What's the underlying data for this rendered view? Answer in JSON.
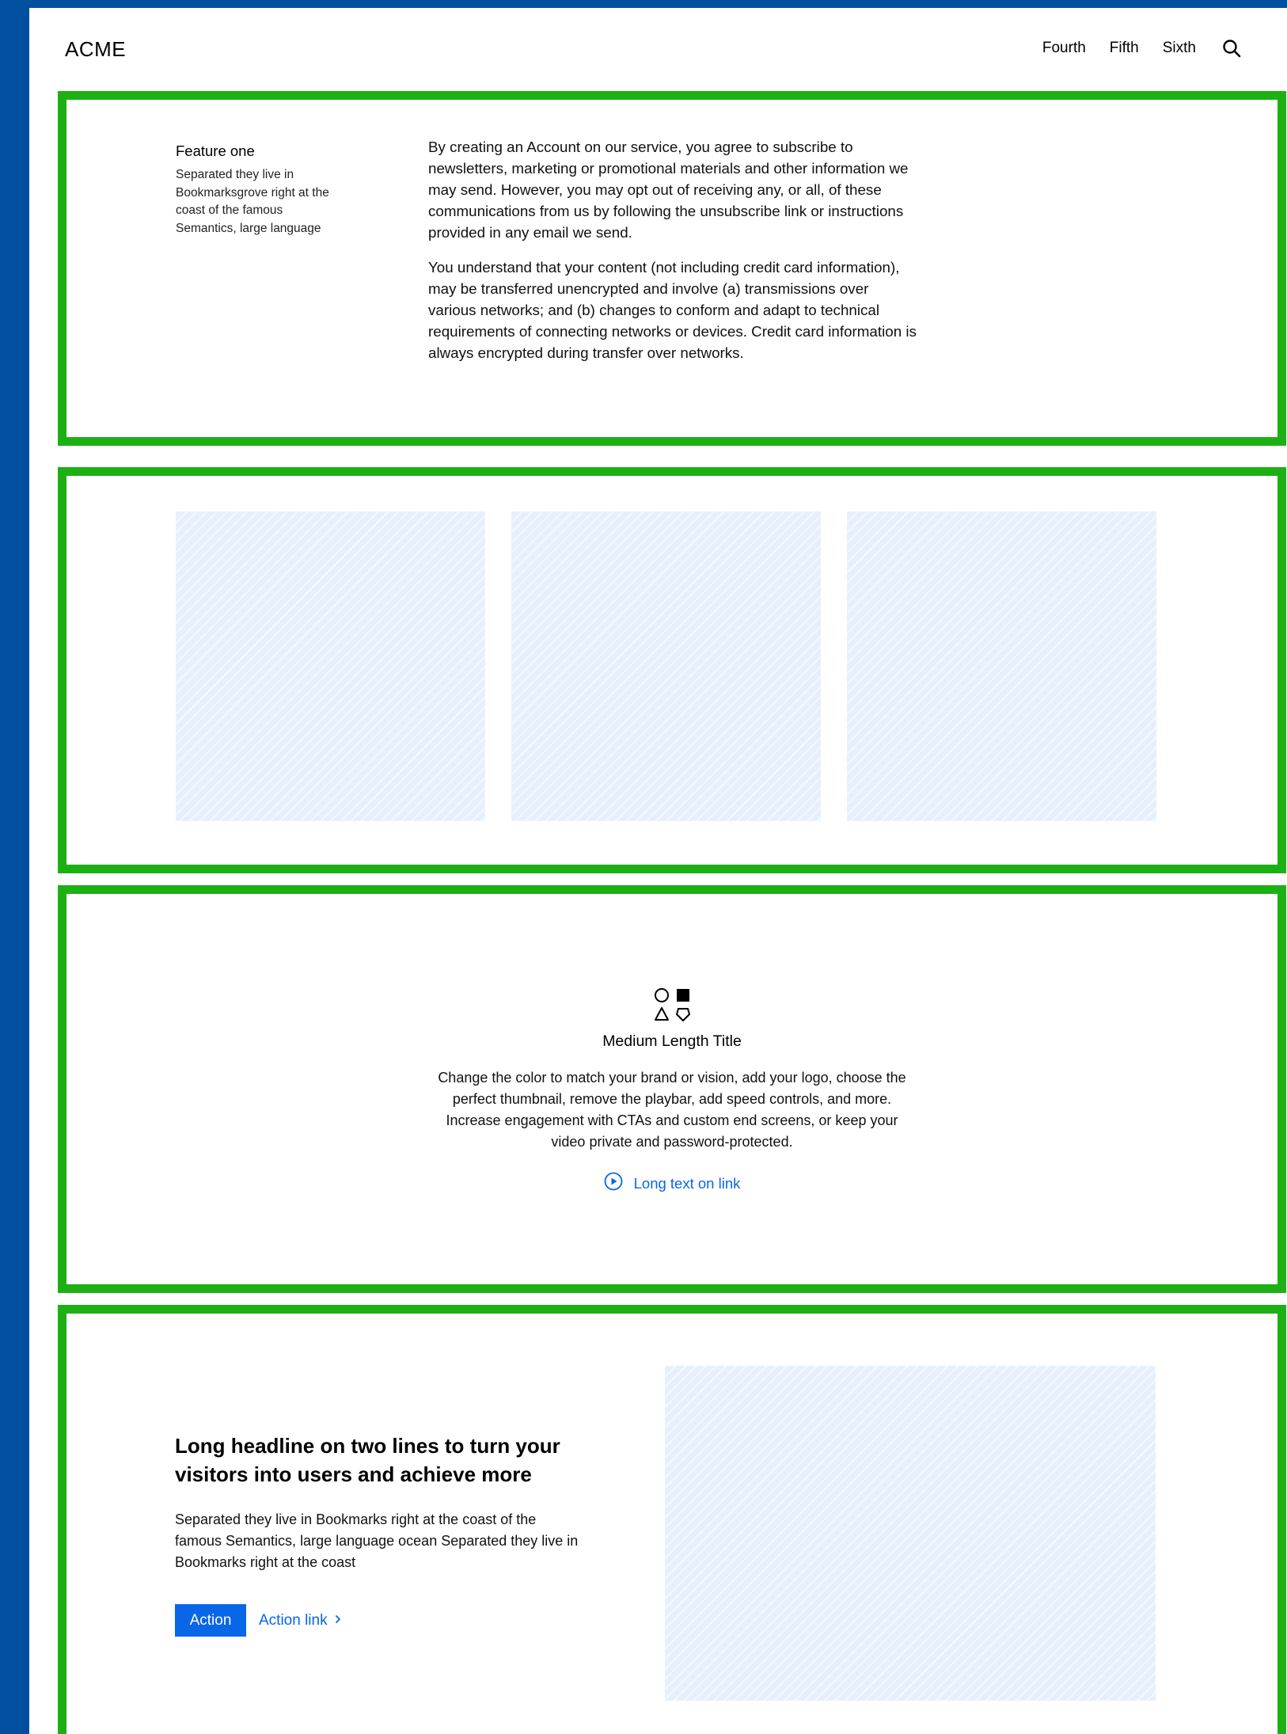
{
  "header": {
    "logo": "ACME",
    "nav": [
      "Fourth",
      "Fifth",
      "Sixth"
    ],
    "search_icon": "search-icon"
  },
  "feature": {
    "title": "Feature one",
    "description": "Separated they live in Bookmarksgrove right at the coast of the famous Semantics, large language",
    "paragraphs": [
      "By creating an Account on our service, you agree to subscribe to newsletters, marketing or promotional materials and other information we may send. However, you may opt out of receiving any, or all, of these communications from us by following the unsubscribe link or instructions provided in any email we send.",
      "You understand that your content (not including credit card information), may be transferred unencrypted and involve (a) transmissions over various networks; and (b) changes to conform and adapt to technical requirements of connecting networks or devices. Credit card information is always encrypted during transfer over networks."
    ]
  },
  "gallery": {
    "placeholder_color": "#e6f0fd"
  },
  "media": {
    "shapes_icon": "shapes-icon",
    "title": "Medium Length Title",
    "description": "Change the color to match your brand or vision, add your logo, choose the perfect thumbnail, remove the playbar, add speed controls, and more. Increase engagement with CTAs and custom end screens, or keep your video private and password-protected.",
    "link_label": "Long text on link",
    "link_icon": "play-circle-icon"
  },
  "cta": {
    "headline": "Long headline on two lines to turn your visitors into users and achieve more",
    "body": "Separated they live in Bookmarks right at the coast of the famous Semantics, large language ocean Separated they live in Bookmarks right at the coast",
    "action_label": "Action",
    "link_label": "Action link",
    "link_icon": "chevron-right-icon"
  },
  "colors": {
    "frame_background": "#00509f",
    "section_border": "#1db014",
    "accent": "#0866e8"
  }
}
